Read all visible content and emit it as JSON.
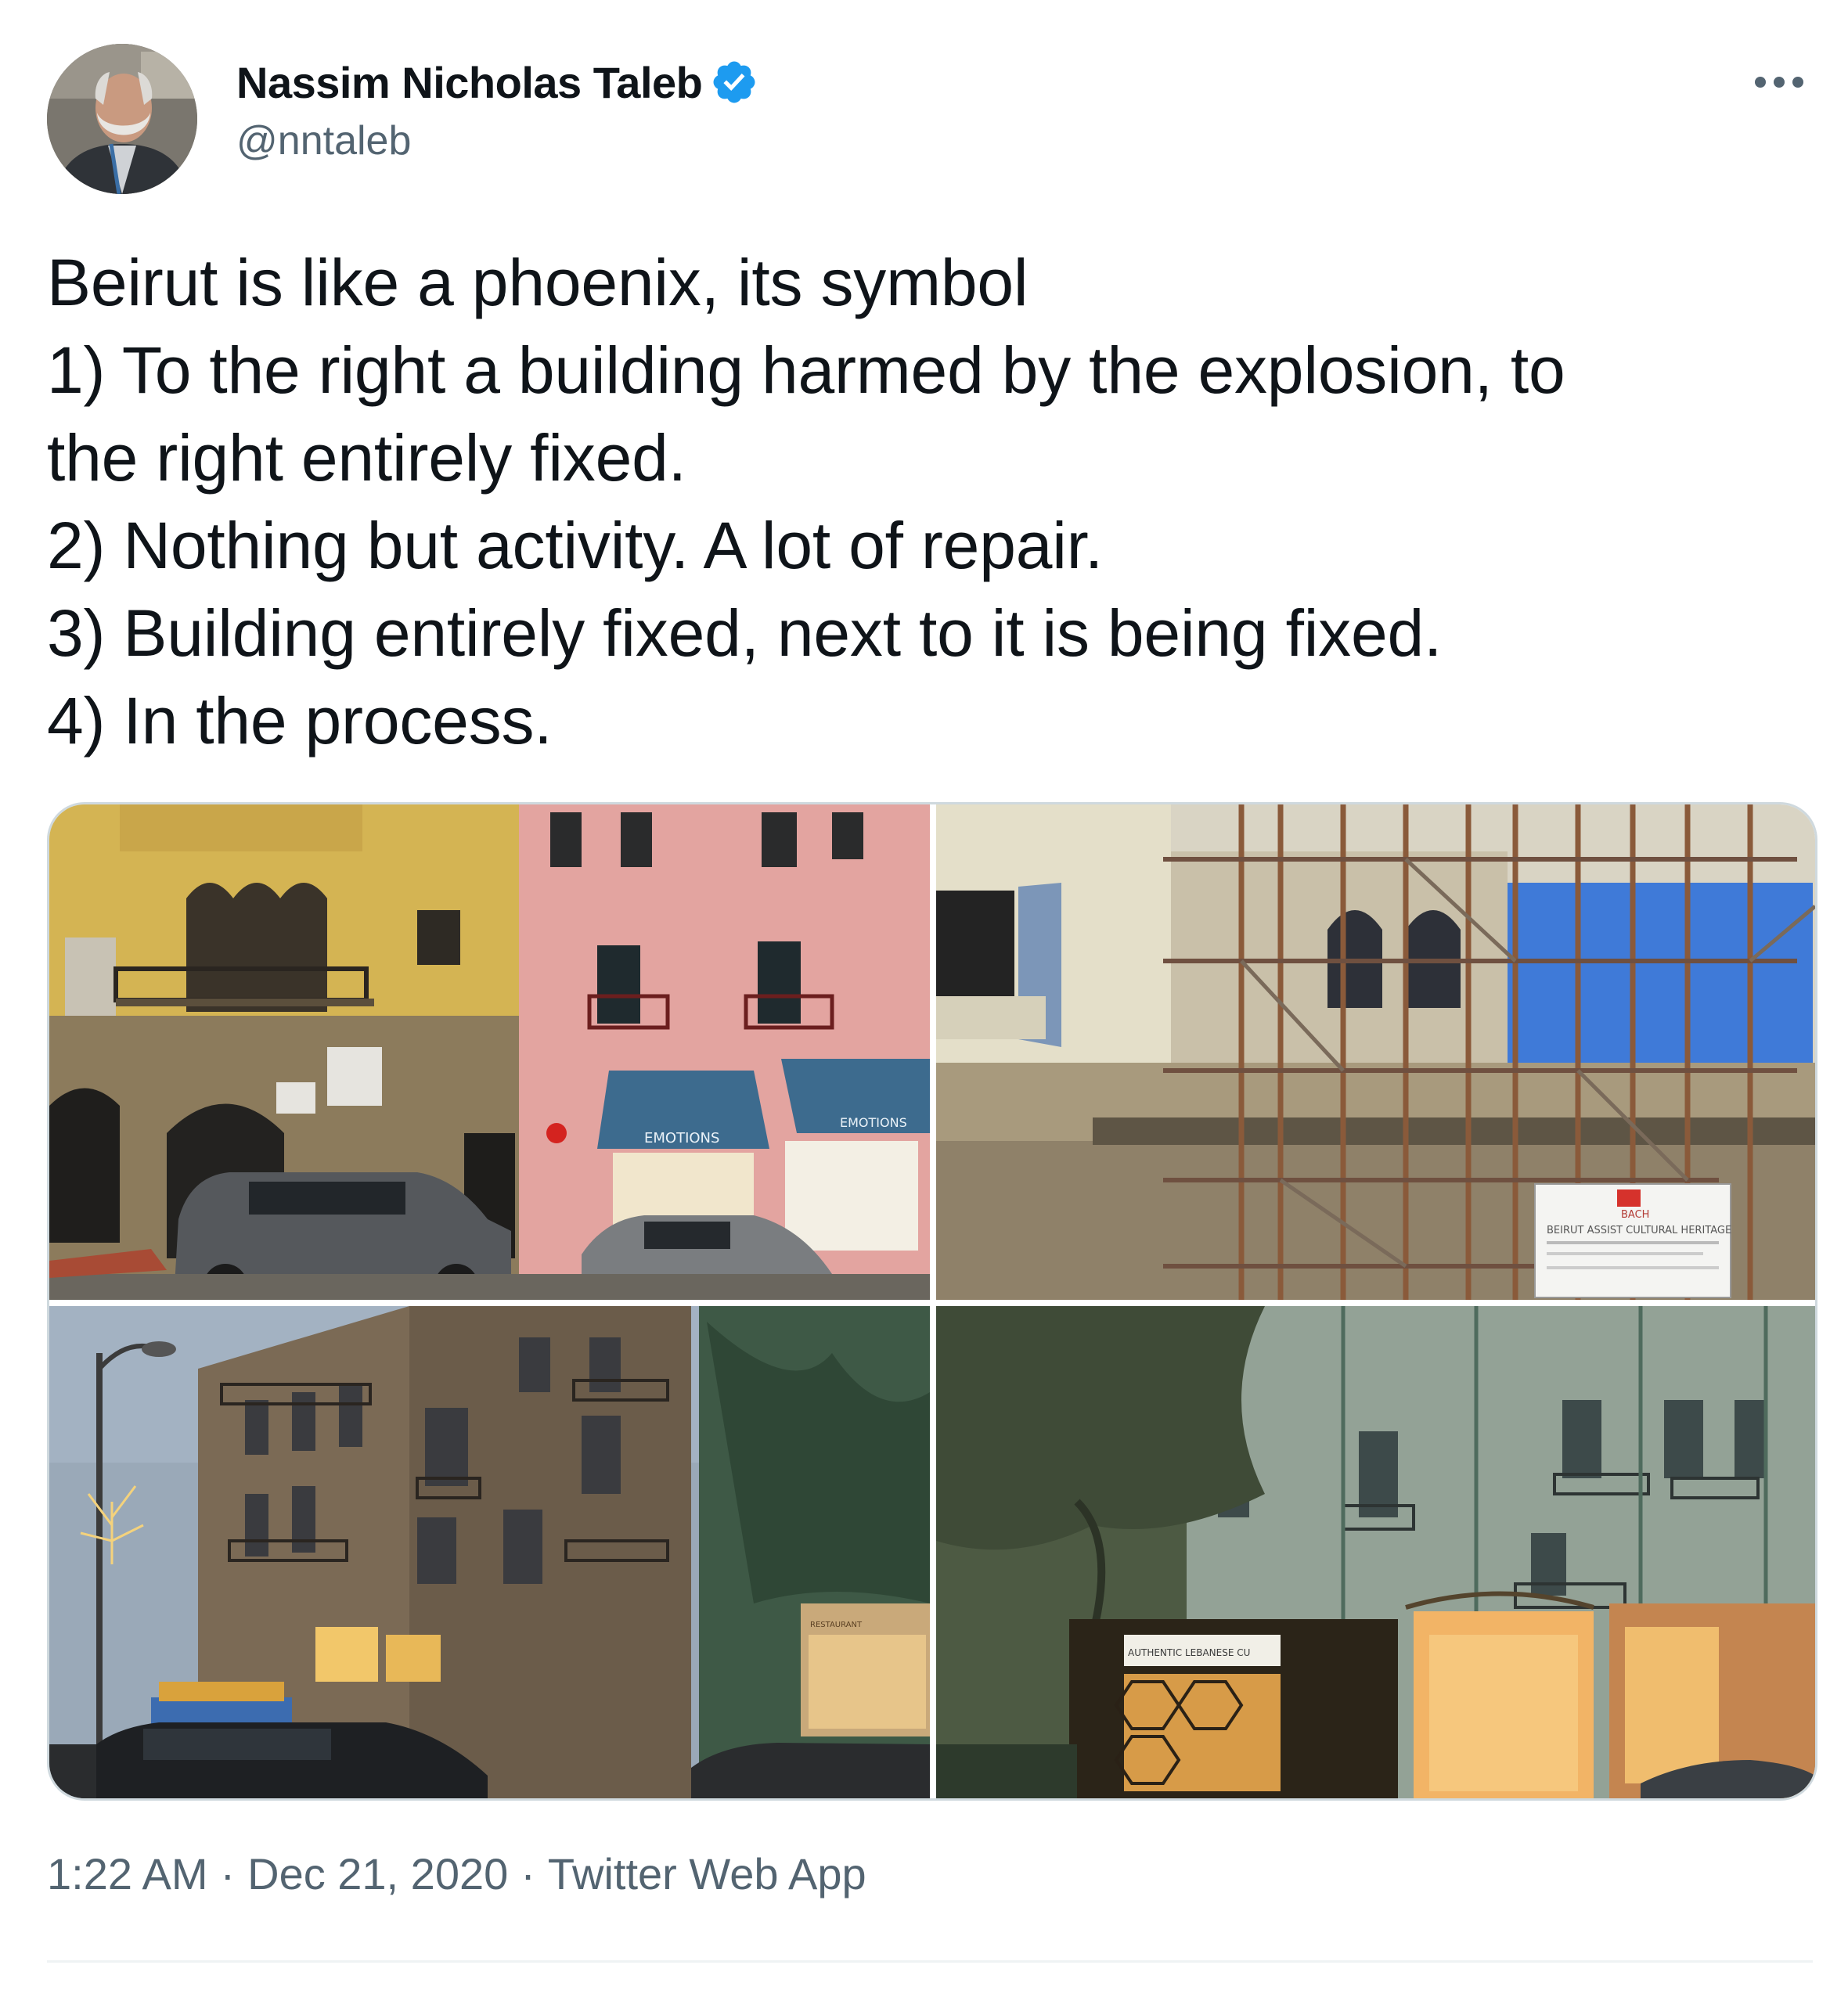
{
  "author": {
    "display_name": "Nassim Nicholas Taleb",
    "handle": "@nntaleb",
    "verified": true,
    "avatar_icon": "profile-photo"
  },
  "menu": {
    "more_icon": "more-horizontal-icon"
  },
  "tweet": {
    "lines": [
      "Beirut is like a phoenix, its symbol",
      "1) To the right a building harmed by the explosion, to",
      "the right entirely fixed.",
      "2) Nothing but activity. A lot of repair.",
      "3) Building entirely fixed, next to it is being fixed.",
      "4) In the process."
    ]
  },
  "media": {
    "photos": [
      {
        "signs": [
          "EMOTIONS",
          "EMOTIONS"
        ]
      },
      {
        "signs": [
          "BACH",
          "BEIRUT ASSIST CULTURAL HERITAGE"
        ]
      },
      {
        "signs": [
          "RESTAURANT"
        ]
      },
      {
        "signs": [
          "AUTHENTIC LEBANESE CU"
        ]
      }
    ]
  },
  "meta": {
    "time": "1:22 AM",
    "date": "Dec 21, 2020",
    "source": "Twitter Web App",
    "separator": "·"
  },
  "colors": {
    "text_primary": "#0f1419",
    "text_secondary": "#536471",
    "verified_blue": "#1d9bf0",
    "border": "#cfd9de"
  }
}
